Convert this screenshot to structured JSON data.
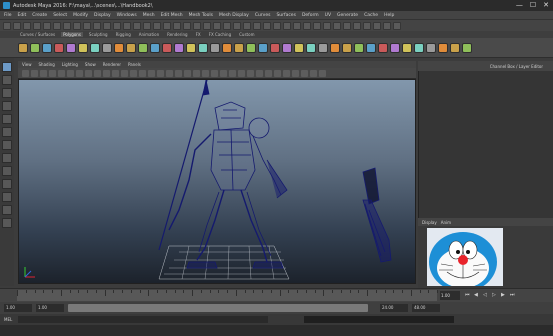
{
  "window": {
    "title": "Autodesk Maya 2016: F:\\maya\\...\\scenes\\...\\Handbook2\\",
    "min": "—",
    "max": "☐",
    "close": "✕"
  },
  "menubar": {
    "items": [
      "File",
      "Edit",
      "Create",
      "Select",
      "Modify",
      "Display",
      "Windows",
      "Mesh",
      "Edit Mesh",
      "Mesh Tools",
      "Mesh Display",
      "Curves",
      "Surfaces",
      "Deform",
      "UV",
      "Generate",
      "Cache",
      "Help"
    ]
  },
  "shelf": {
    "tabs": [
      "Curves / Surfaces",
      "Polygons",
      "Sculpting",
      "Rigging",
      "Animation",
      "Rendering",
      "FX",
      "FX Caching",
      "Custom"
    ]
  },
  "panel_menu": {
    "items": [
      "View",
      "Shading",
      "Lighting",
      "Show",
      "Renderer",
      "Panels"
    ]
  },
  "side_header": {
    "label": "Channel Box / Layer Editor"
  },
  "layers_bar": {
    "items": [
      "Display",
      "Anim"
    ]
  },
  "timeslider": {
    "current_frame": "1.00"
  },
  "rangeslider": {
    "start": "1.00",
    "start_inner": "1.00",
    "end_inner": "24.00",
    "end": "48.00"
  },
  "cmdline": {
    "language": "MEL"
  },
  "colors": {
    "accent": "#6d9ac7",
    "wireframe": "#151a6e",
    "viewport_top": "#8297ac",
    "viewport_bottom": "#1c222b"
  }
}
